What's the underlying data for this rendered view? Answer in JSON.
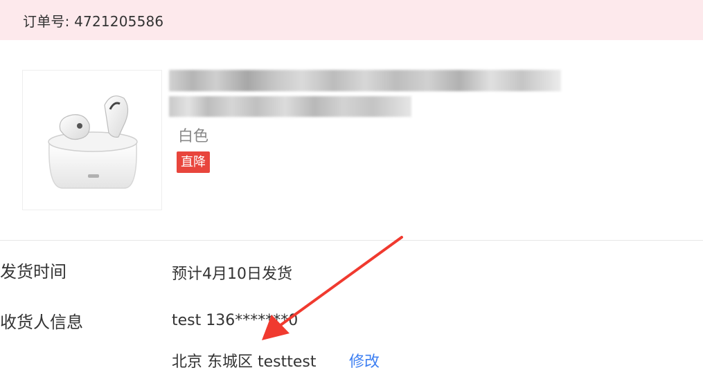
{
  "order": {
    "label": "订单号: 4721205586"
  },
  "product": {
    "color": "白色",
    "badge": "直降"
  },
  "shipping": {
    "label": "发货时间",
    "value": "预计4月10日发货"
  },
  "receiver": {
    "label": "收货人信息",
    "name_phone": "test 136*******0",
    "address": "北京 东城区 testtest",
    "edit_label": "修改"
  },
  "colors": {
    "order_bar_bg": "#fde9ec",
    "badge_bg": "#e8453c",
    "link": "#3d7ff2",
    "annotation_arrow": "#f03a2f"
  },
  "icons": {
    "product_thumbnail": "earbuds-case-image",
    "annotation": "red-arrow-icon"
  }
}
